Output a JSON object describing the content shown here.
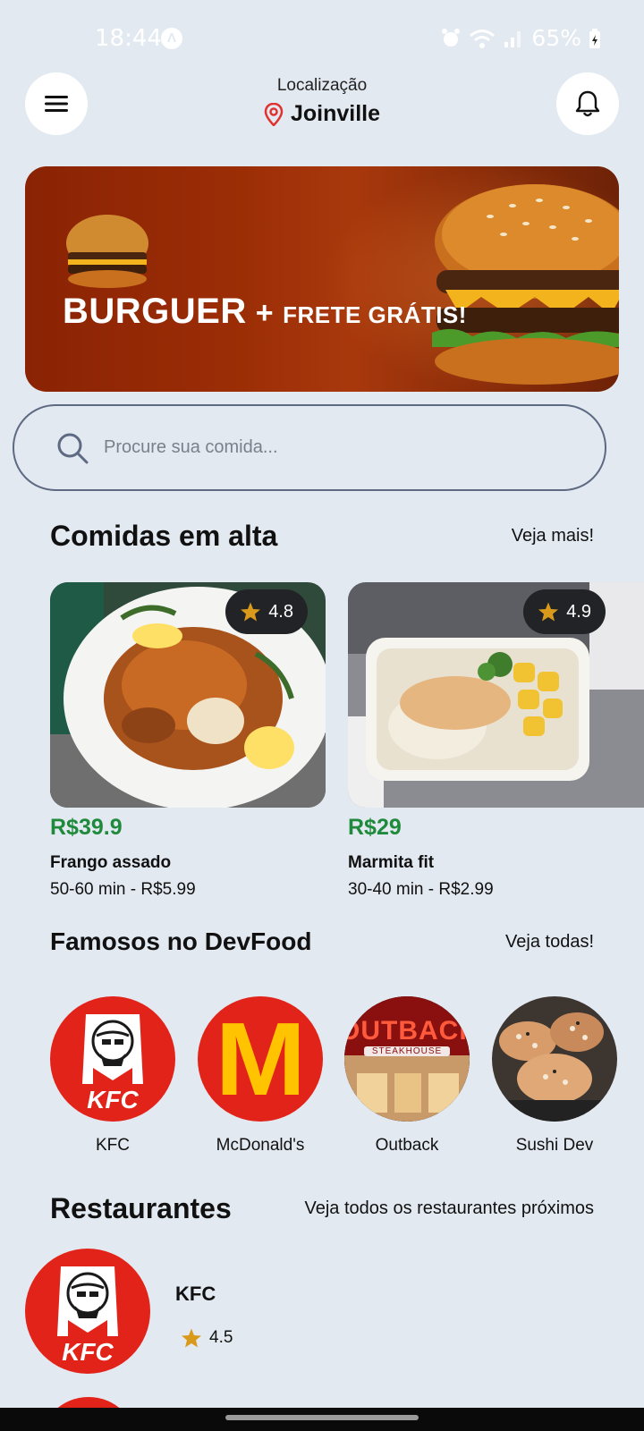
{
  "status_bar": {
    "time": "18:44",
    "app_glyph": "Λ",
    "battery": "65%",
    "icons": [
      "alarm-icon",
      "wifi-icon",
      "signal-icon",
      "battery-icon"
    ]
  },
  "header": {
    "location_caption": "Localização",
    "city": "Joinville",
    "icons": [
      "menu-icon",
      "location-pin-icon",
      "bell-icon"
    ]
  },
  "banner": {
    "headline": "BURGUER",
    "plus": "+",
    "subline": "FRETE GRÁTIS!"
  },
  "search": {
    "placeholder": "Procure sua comida..."
  },
  "trending": {
    "title": "Comidas em alta",
    "link": "Veja mais!",
    "items": [
      {
        "rating": "4.8",
        "price": "R$39.9",
        "name": "Frango assado",
        "meta": "50-60 min - R$5.99"
      },
      {
        "rating": "4.9",
        "price": "R$29",
        "name": "Marmita fit",
        "meta": "30-40 min - R$2.99"
      }
    ]
  },
  "famous": {
    "title": "Famosos no DevFood",
    "link": "Veja todas!",
    "items": [
      {
        "name": "KFC",
        "logo_text": "KFC"
      },
      {
        "name": "McDonald's",
        "logo_text": "M"
      },
      {
        "name": "Outback",
        "logo_text": "OUTBACK",
        "logo_subtext": "STEAKHOUSE"
      },
      {
        "name": "Sushi Dev"
      }
    ]
  },
  "restaurants": {
    "title": "Restaurantes",
    "link": "Veja todos os restaurantes próximos",
    "items": [
      {
        "name": "KFC",
        "rating": "4.5",
        "logo_text": "KFC"
      }
    ]
  },
  "colors": {
    "background": "#e3e9f1",
    "price_green": "#1f8a3c",
    "star": "#d99a1c",
    "banner": "#9b2d06"
  }
}
